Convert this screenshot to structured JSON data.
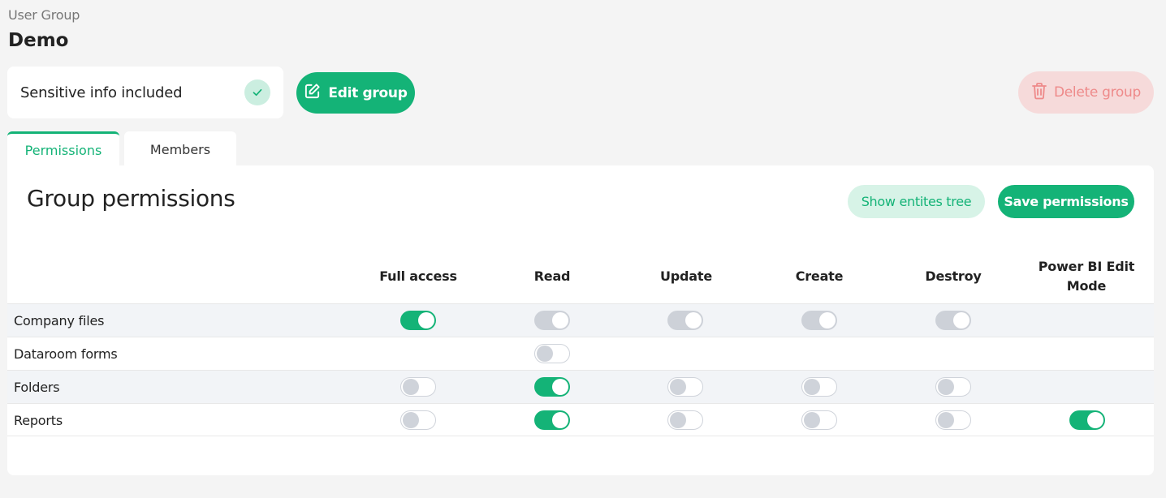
{
  "header": {
    "overline": "User Group",
    "title": "Demo"
  },
  "sensitive": {
    "label": "Sensitive info included",
    "checked": true
  },
  "actions": {
    "edit_label": "Edit group",
    "delete_label": "Delete group"
  },
  "tabs": [
    {
      "label": "Permissions",
      "active": true
    },
    {
      "label": "Members",
      "active": false
    }
  ],
  "panel": {
    "title": "Group permissions",
    "show_tree_label": "Show entites tree",
    "save_label": "Save permissions"
  },
  "columns": [
    "Full access",
    "Read",
    "Update",
    "Create",
    "Destroy",
    "Power BI Edit Mode"
  ],
  "rows": [
    {
      "label": "Company files",
      "toggles": [
        "on",
        "disabled",
        "disabled",
        "disabled",
        "disabled",
        null
      ]
    },
    {
      "label": "Dataroom forms",
      "toggles": [
        null,
        "off",
        null,
        null,
        null,
        null
      ]
    },
    {
      "label": "Folders",
      "toggles": [
        "off",
        "on",
        "off",
        "off",
        "off",
        null
      ]
    },
    {
      "label": "Reports",
      "toggles": [
        "off",
        "on",
        "off",
        "off",
        "off",
        "on"
      ]
    }
  ],
  "colors": {
    "accent": "#14b377",
    "danger": "#ee8a8a"
  }
}
